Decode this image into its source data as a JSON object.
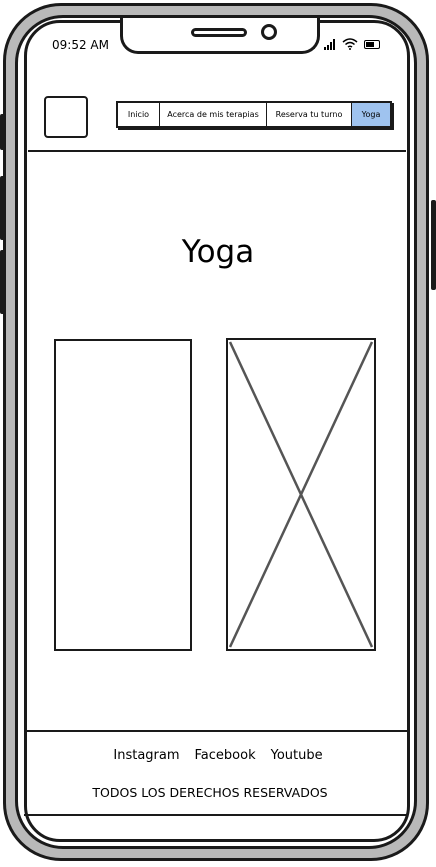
{
  "status_bar": {
    "time": "09:52 AM"
  },
  "nav": {
    "items": [
      {
        "label": "Inicio",
        "active": false
      },
      {
        "label": "Acerca de mis terapias",
        "active": false
      },
      {
        "label": "Reserva tu turno",
        "active": false
      },
      {
        "label": "Yoga",
        "active": true
      }
    ],
    "active_color": "#9fc3ef"
  },
  "page": {
    "title": "Yoga"
  },
  "images": [
    {
      "kind": "image-frame",
      "crossed": false
    },
    {
      "kind": "image-placeholder",
      "crossed": true
    }
  ],
  "footer": {
    "links": [
      "Instagram",
      "Facebook",
      "Youtube"
    ],
    "rights": "TODOS LOS DERECHOS RESERVADOS"
  },
  "icons": [
    "signal-icon",
    "wifi-icon",
    "battery-icon",
    "logo-placeholder"
  ]
}
